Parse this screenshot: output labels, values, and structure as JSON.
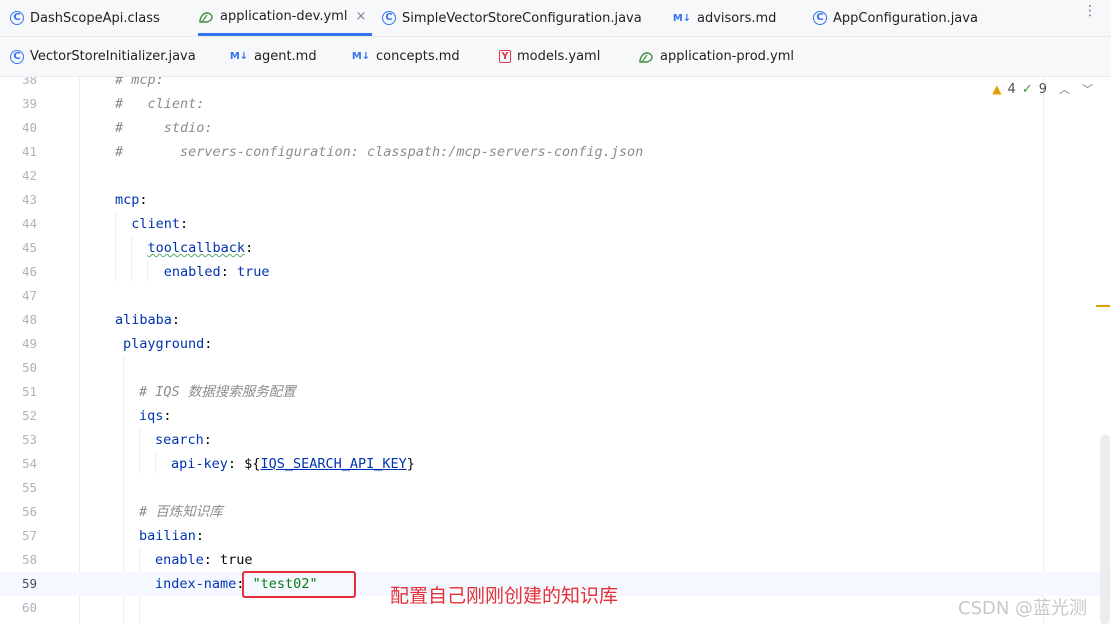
{
  "tabs_row1": [
    {
      "label": "DashScopeApi.class",
      "icon": "C"
    },
    {
      "label": "application-dev.yml",
      "icon": "yml",
      "active": true,
      "close": "×"
    },
    {
      "label": "SimpleVectorStoreConfiguration.java",
      "icon": "C"
    },
    {
      "label": "advisors.md",
      "icon": "M↓"
    },
    {
      "label": "AppConfiguration.java",
      "icon": "C"
    }
  ],
  "tabs_row2": [
    {
      "label": "VectorStoreInitializer.java",
      "icon": "C"
    },
    {
      "label": "agent.md",
      "icon": "M↓"
    },
    {
      "label": "concepts.md",
      "icon": "M↓"
    },
    {
      "label": "models.yaml",
      "icon": "Y"
    },
    {
      "label": "application-prod.yml",
      "icon": "yml"
    }
  ],
  "inspection": {
    "warnings": "4",
    "ok": "9"
  },
  "line_numbers": [
    "38",
    "39",
    "40",
    "41",
    "42",
    "43",
    "44",
    "45",
    "46",
    "47",
    "48",
    "49",
    "50",
    "51",
    "52",
    "53",
    "54",
    "55",
    "56",
    "57",
    "58",
    "59",
    "60"
  ],
  "code": {
    "l38": "# mcp:",
    "l39": "#   client:",
    "l40": "#     stdio:",
    "l41": "#       servers-configuration: classpath:/mcp-servers-config.json",
    "l43_key": "mcp",
    "l44_key": "client",
    "l45_key": "toolcallback",
    "l46_key": "enabled",
    "l46_val": "true",
    "l48_key": "alibaba",
    "l49_key": "playground",
    "l51": "# IQS 数据搜索服务配置",
    "l52_key": "iqs",
    "l53_key": "search",
    "l54_key": "api-key",
    "l54_pre": "${",
    "l54_ref": "IQS_SEARCH_API_KEY",
    "l54_post": "}",
    "l56": "# 百炼知识库",
    "l57_key": "bailian",
    "l58_key": "enable",
    "l58_val": "true",
    "l59_key": "index-name",
    "l59_val": "\"test02\""
  },
  "annotation": "配置自己刚刚创建的知识库",
  "watermark": "CSDN @蓝光测"
}
